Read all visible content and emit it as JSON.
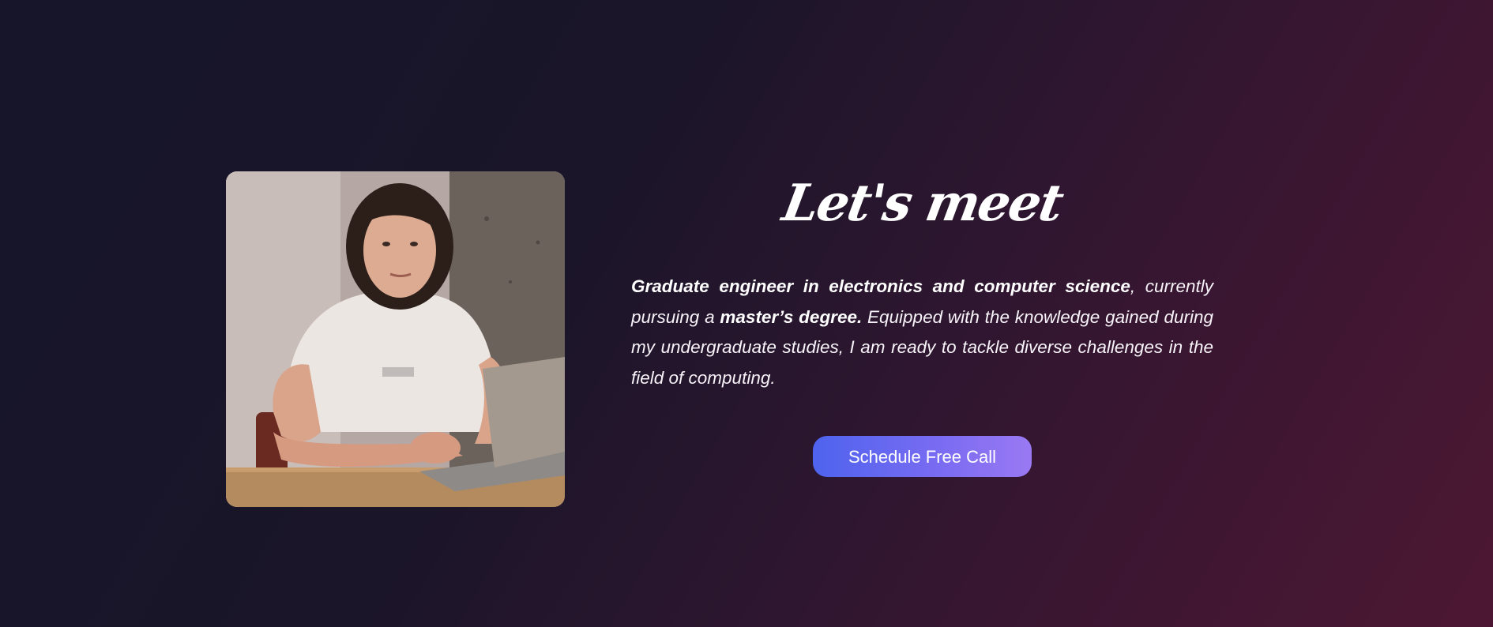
{
  "about": {
    "title": "Let's meet",
    "bio": {
      "bold_1": "Graduate engineer in electronics and computer science",
      "text_1": ", currently pursuing a ",
      "bold_2": "master’s degree.",
      "text_2": " Equipped with the knowledge gained during my undergraduate studies, I am ready to tackle diverse challenges in the field of computing."
    },
    "cta_label": "Schedule Free Call",
    "photo_icon": "portrait-photo-icon"
  },
  "colors": {
    "background_start": "#16152a",
    "background_end": "#4d1733",
    "button_start": "#4e63ee",
    "button_end": "#9a79f3",
    "text": "#ffffff"
  }
}
